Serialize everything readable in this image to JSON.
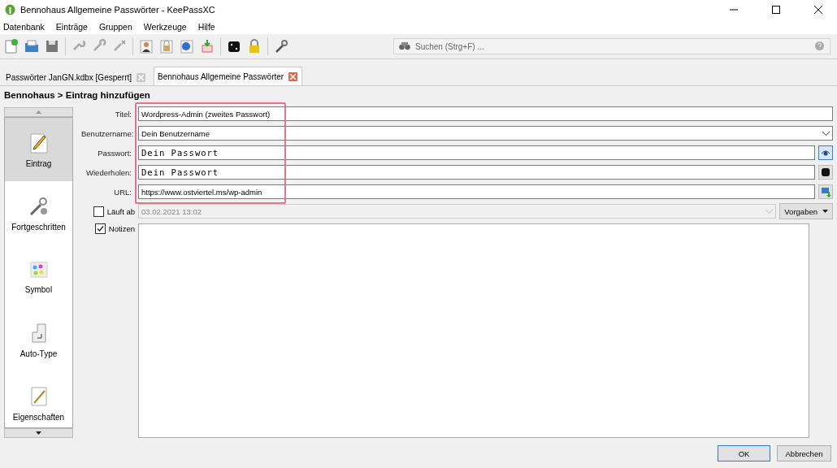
{
  "window": {
    "title": "Bennohaus Allgemeine Passwörter - KeePassXC"
  },
  "menu": [
    "Datenbank",
    "Einträge",
    "Gruppen",
    "Werkzeuge",
    "Hilfe"
  ],
  "search": {
    "placeholder": "Suchen (Strg+F) ..."
  },
  "tabs": [
    {
      "label": "Passwörter JanGN.kdbx [Gesperrt]",
      "selected": false
    },
    {
      "label": "Bennohaus Allgemeine Passwörter",
      "selected": true
    }
  ],
  "breadcrumb": "Bennohaus > Eintrag hinzufügen",
  "sidebar": {
    "items": [
      {
        "label": "Eintrag",
        "kind": "entry",
        "selected": true
      },
      {
        "label": "Fortgeschritten",
        "kind": "advanced",
        "selected": false
      },
      {
        "label": "Symbol",
        "kind": "icon",
        "selected": false
      },
      {
        "label": "Auto-Type",
        "kind": "autotype",
        "selected": false
      },
      {
        "label": "Eigenschaften",
        "kind": "properties",
        "selected": false
      }
    ]
  },
  "fields": [
    {
      "kind": "text",
      "label": "Titel:",
      "value": "Wordpress-Admin (zweites Passwort)"
    },
    {
      "kind": "combo",
      "label": "Benutzername:",
      "value": "Dein Benutzername"
    },
    {
      "kind": "reveal",
      "label": "Passwort:",
      "value": "Dein Passwort"
    },
    {
      "kind": "generate",
      "label": "Wiederholen:",
      "value": "Dein Passwort"
    },
    {
      "kind": "url",
      "label": "URL:",
      "value": "https://www.ostviertel.ms/wp-admin"
    }
  ],
  "expires": {
    "label": "Läuft ab",
    "checked": false,
    "disabled": true,
    "value": "03.02.2021 13:02",
    "presets": "Vorgaben"
  },
  "notes": {
    "label": "Notizen",
    "checked": true
  },
  "buttons": [
    {
      "label": "OK",
      "default": true
    },
    {
      "label": "Abbrechen",
      "default": false
    }
  ]
}
